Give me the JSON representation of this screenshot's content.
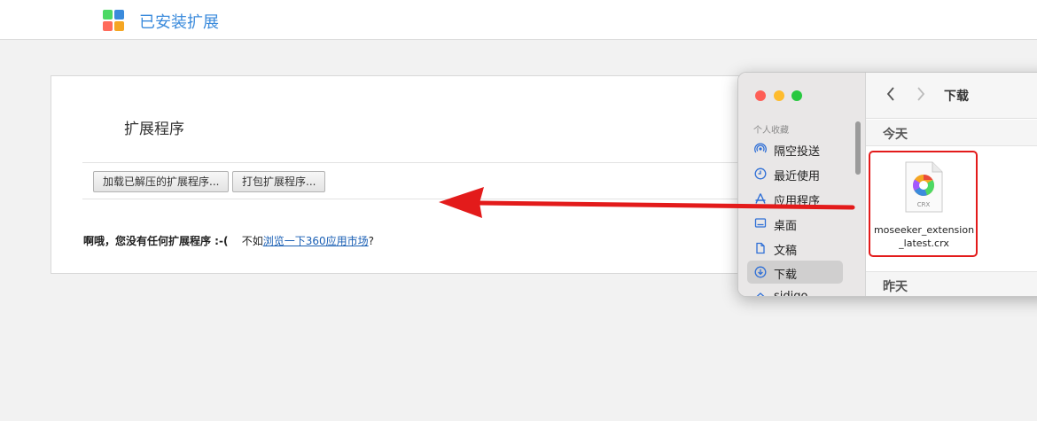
{
  "header": {
    "title": "已安装扩展",
    "logo_colors": [
      "#4cd964",
      "#3b8bdc",
      "#ff6b5b",
      "#f5a623"
    ]
  },
  "extensions": {
    "section_title": "扩展程序",
    "load_unpacked_button": "加载已解压的扩展程序...",
    "pack_button": "打包扩展程序...",
    "empty_message": "啊哦，您没有任何扩展程序 :-(",
    "suggestion_prefix": "不如",
    "market_link": "浏览一下360应用市场",
    "suggestion_suffix": "?"
  },
  "finder": {
    "traffic_colors": [
      "#fe5f57",
      "#febc2e",
      "#28c840"
    ],
    "favorites_header": "个人收藏",
    "sidebar_items": [
      {
        "label": "隔空投送",
        "icon": "airdrop-icon"
      },
      {
        "label": "最近使用",
        "icon": "clock-icon"
      },
      {
        "label": "应用程序",
        "icon": "apps-icon"
      },
      {
        "label": "桌面",
        "icon": "desktop-icon"
      },
      {
        "label": "文稿",
        "icon": "document-icon"
      },
      {
        "label": "下载",
        "icon": "download-icon",
        "active": true
      },
      {
        "label": "sidigo",
        "icon": "home-icon"
      }
    ],
    "back_glyph": "‹",
    "forward_glyph": "›",
    "folder_title": "下载",
    "group_today": "今天",
    "group_yesterday": "昨天",
    "file": {
      "name": "moseeker_extension_latest.crx",
      "type_label": "CRX"
    }
  },
  "annotation": {
    "arrow_color": "#e31b1b"
  }
}
